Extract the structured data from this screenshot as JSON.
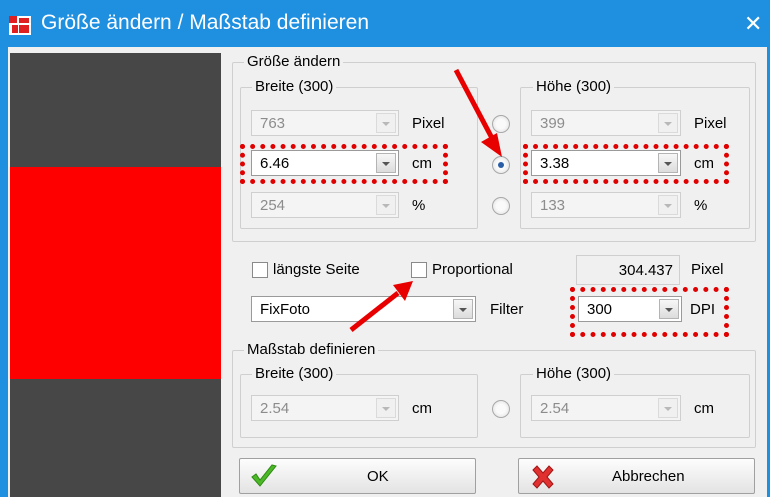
{
  "window": {
    "title": "Größe ändern / Maßstab definieren",
    "close": "✕"
  },
  "resize": {
    "legend": "Größe ändern",
    "width": {
      "legend": "Breite (300)",
      "pixel": {
        "value": "763",
        "unit": "Pixel"
      },
      "cm": {
        "value": "6.46",
        "unit": "cm"
      },
      "percent": {
        "value": "254",
        "unit": "%"
      }
    },
    "height": {
      "legend": "Höhe (300)",
      "pixel": {
        "value": "399",
        "unit": "Pixel"
      },
      "cm": {
        "value": "3.38",
        "unit": "cm"
      },
      "percent": {
        "value": "133",
        "unit": "%"
      }
    },
    "selected_unit": "cm"
  },
  "options": {
    "longest_side": {
      "label": "längste Seite",
      "checked": false
    },
    "proportional": {
      "label": "Proportional",
      "checked": false
    },
    "longest_pixel_value": "304.437",
    "longest_pixel_unit": "Pixel",
    "filter": {
      "value": "FixFoto",
      "label": "Filter"
    },
    "dpi": {
      "value": "300",
      "unit": "DPI"
    }
  },
  "scale": {
    "legend": "Maßstab definieren",
    "width": {
      "legend": "Breite (300)",
      "value": "2.54",
      "unit": "cm"
    },
    "height": {
      "legend": "Höhe (300)",
      "value": "2.54",
      "unit": "cm"
    }
  },
  "buttons": {
    "ok": "OK",
    "cancel": "Abbrechen"
  },
  "colors": {
    "titlebar": "#1f8fe0",
    "highlight": "#e00000",
    "preview_bg": "#474747",
    "preview_fill": "#ff0000"
  },
  "icons": {
    "app": "resize-app-icon",
    "ok": "green-check-icon",
    "cancel": "red-x-icon"
  }
}
